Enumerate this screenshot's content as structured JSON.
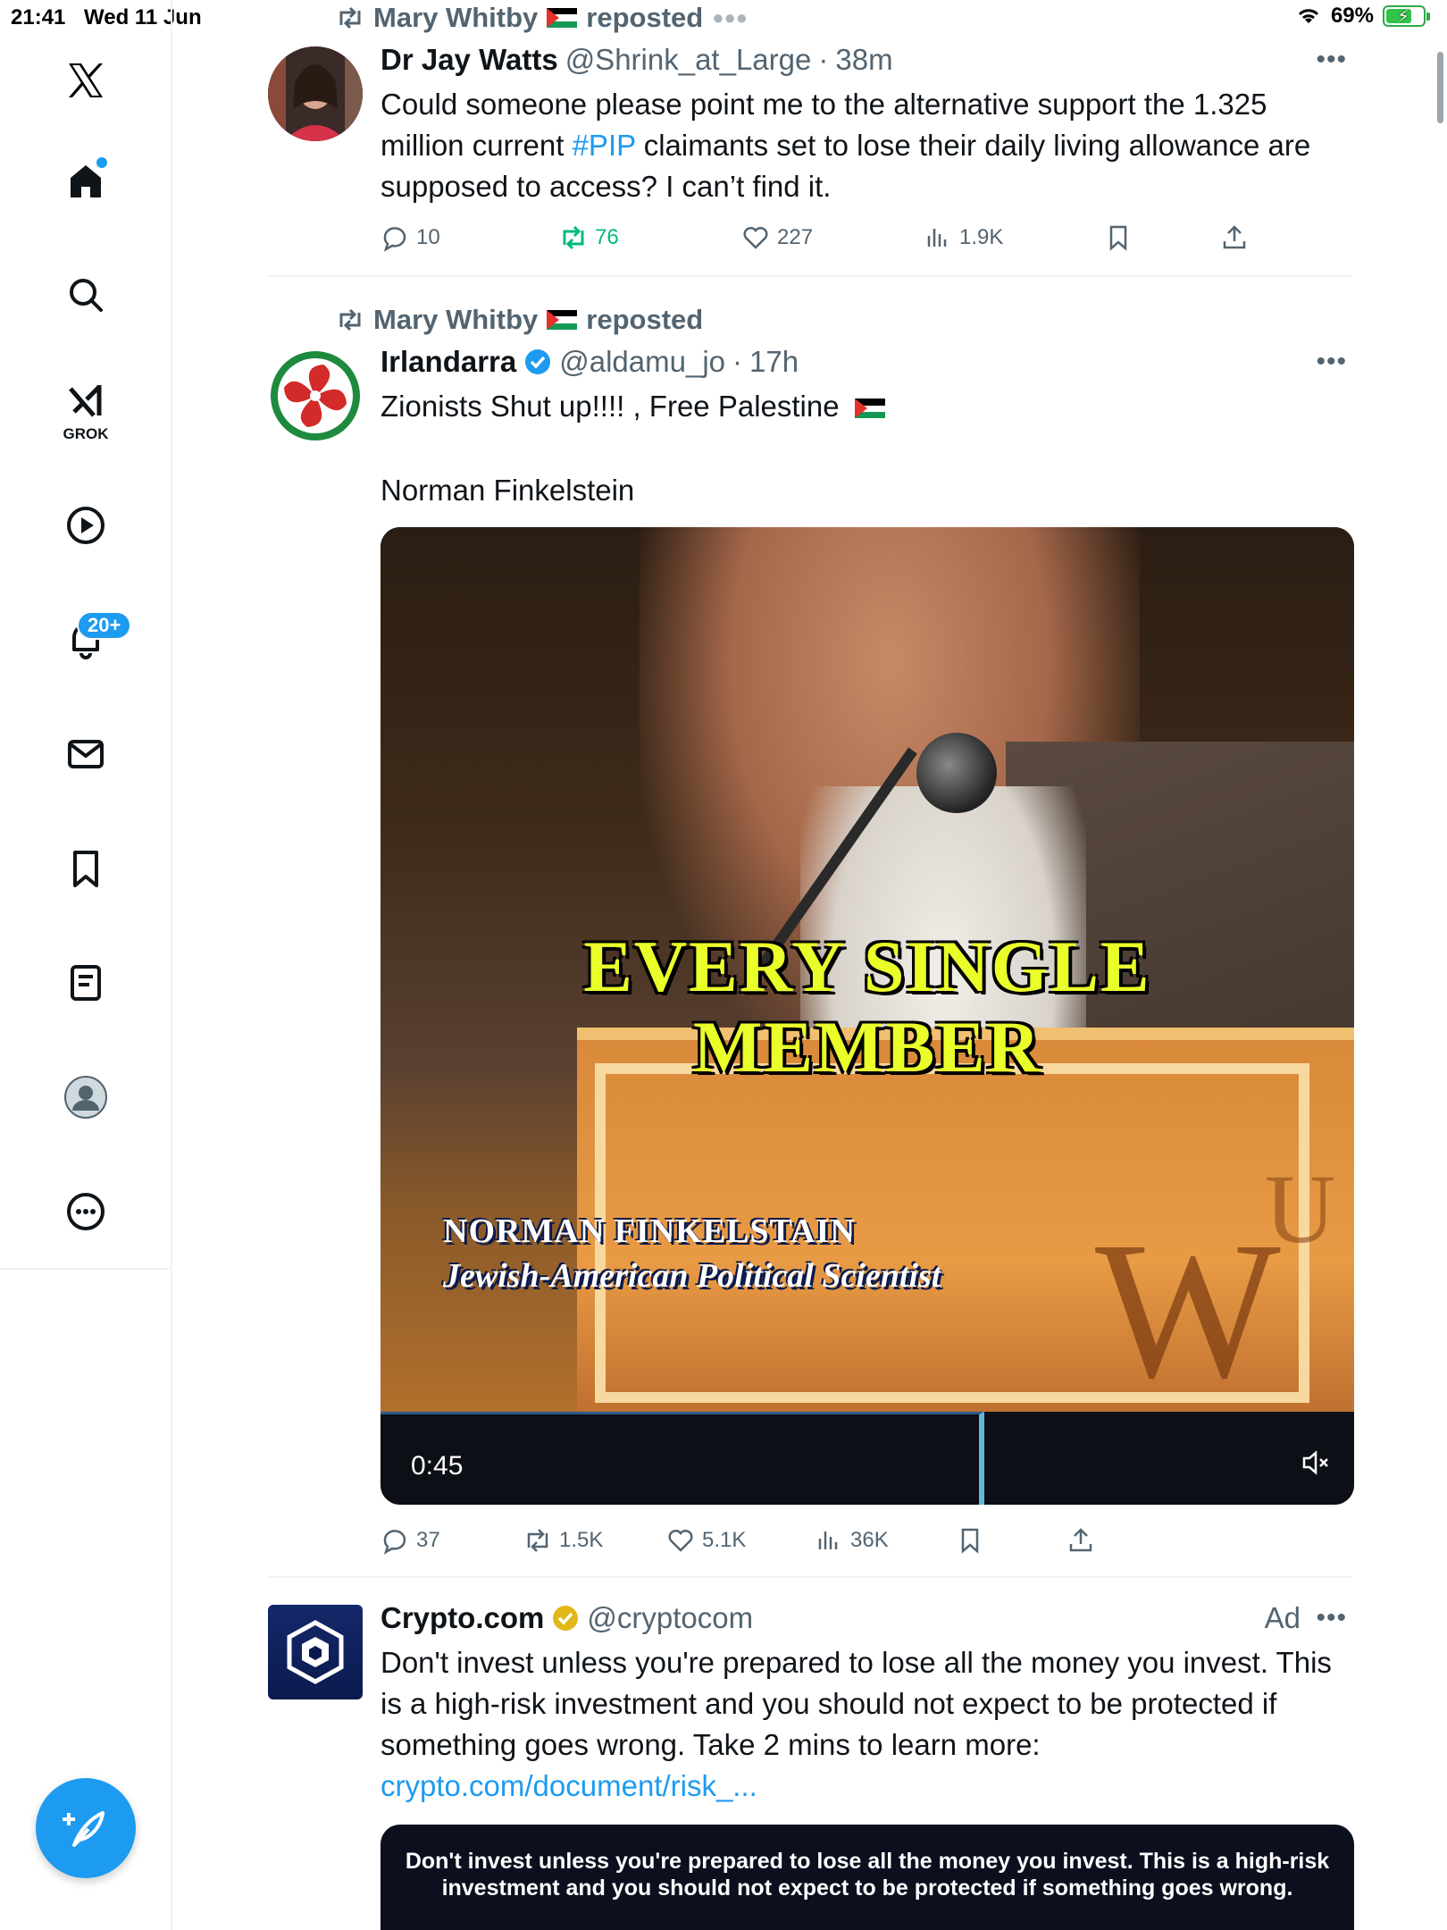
{
  "status_bar": {
    "time": "21:41",
    "date": "Wed 11 Jun",
    "battery": "69%",
    "battery_level": 0.69
  },
  "sidebar": {
    "items": [
      {
        "name": "x-logo",
        "label": "X"
      },
      {
        "name": "home",
        "label": "Home"
      },
      {
        "name": "search",
        "label": "Search"
      },
      {
        "name": "grok",
        "label": "GROK"
      },
      {
        "name": "video",
        "label": "Video"
      },
      {
        "name": "notifications",
        "label": "Notifications",
        "badge": "20+"
      },
      {
        "name": "messages",
        "label": "Messages"
      },
      {
        "name": "bookmarks",
        "label": "Bookmarks"
      },
      {
        "name": "lists",
        "label": "Lists"
      },
      {
        "name": "profile",
        "label": "Profile"
      },
      {
        "name": "more",
        "label": "More"
      }
    ],
    "compose_label": "Post"
  },
  "posts": [
    {
      "repost_by": "Mary Whitby",
      "repost_suffix": "reposted",
      "author": "Dr Jay Watts",
      "handle": "@Shrink_at_Large",
      "time": "38m",
      "text_before": "Could someone please point me to the alternative support the 1.325 million current ",
      "hashtag": "#PIP",
      "text_after": " claimants set to lose their daily living allowance are supposed to access? I can’t find it.",
      "replies": "10",
      "reposts": "76",
      "likes": "227",
      "views": "1.9K"
    },
    {
      "repost_by": "Mary Whitby",
      "repost_suffix": "reposted",
      "author": "Irlandarra",
      "handle": "@aldamu_jo",
      "time": "17h",
      "text_line1": "Zionists Shut up!!!! , Free Palestine",
      "text_line2": "Norman Finkelstein",
      "video": {
        "caption_line1": "EVERY SINGLE",
        "caption_line2": "MEMBER",
        "name_caption": "NORMAN FINKELSTAIN",
        "role_caption": "Jewish-American Political Scientist",
        "duration": "0:45",
        "progress": 0.62
      },
      "replies": "37",
      "reposts": "1.5K",
      "likes": "5.1K",
      "views": "36K"
    },
    {
      "author": "Crypto.com",
      "handle": "@cryptocom",
      "ad_label": "Ad",
      "text": "Don't invest unless you're prepared to lose all the money you invest. This is a high-risk investment and you should not expect to be protected if something goes wrong. Take 2 mins to learn more:",
      "link": "crypto.com/document/risk_...",
      "banner_text": "Don't invest unless you're prepared to lose all the money you invest. This is a high-risk investment and you should not expect to be protected if something goes wrong."
    }
  ],
  "colors": {
    "accent": "#1d9bf0",
    "repost_green": "#00ba7c",
    "muted": "#536471"
  }
}
